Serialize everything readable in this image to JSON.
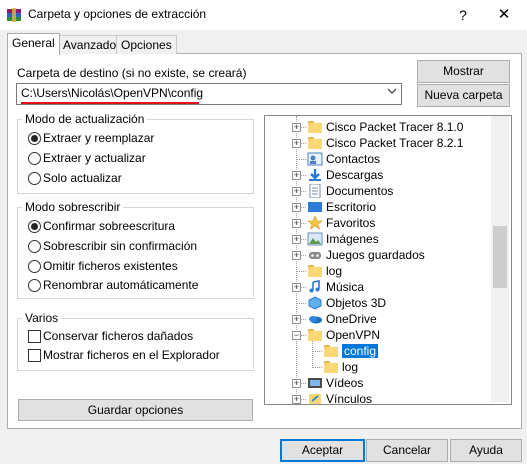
{
  "window": {
    "title": "Carpeta y opciones de extracción",
    "help_label": "?",
    "close_label": "✕"
  },
  "tabs": [
    {
      "label": "General",
      "active": true
    },
    {
      "label": "Avanzado",
      "active": false
    },
    {
      "label": "Opciones",
      "active": false
    }
  ],
  "destination": {
    "label": "Carpeta de destino (si no existe, se creará)",
    "value": "C:\\Users\\Nicolás\\OpenVPN\\config"
  },
  "buttons": {
    "show": "Mostrar",
    "new_folder": "Nueva carpeta",
    "save_options": "Guardar opciones",
    "accept": "Aceptar",
    "cancel": "Cancelar",
    "help": "Ayuda"
  },
  "update_mode": {
    "title": "Modo de actualización",
    "options": [
      {
        "label": "Extraer y reemplazar",
        "selected": true
      },
      {
        "label": "Extraer y actualizar",
        "selected": false
      },
      {
        "label": "Solo actualizar",
        "selected": false
      }
    ]
  },
  "overwrite_mode": {
    "title": "Modo sobrescribir",
    "options": [
      {
        "label": "Confirmar sobreescritura",
        "selected": true
      },
      {
        "label": "Sobrescribir sin confirmación",
        "selected": false
      },
      {
        "label": "Omitir ficheros existentes",
        "selected": false
      },
      {
        "label": "Renombrar automáticamente",
        "selected": false
      }
    ]
  },
  "misc": {
    "title": "Varios",
    "options": [
      {
        "label": "Conservar ficheros dañados",
        "checked": false
      },
      {
        "label": "Mostrar ficheros en el Explorador",
        "checked": false
      }
    ]
  },
  "tree": {
    "items": [
      {
        "label": "Cisco Packet Tracer 8.1.0",
        "icon": "folder-icon",
        "expandable": true
      },
      {
        "label": "Cisco Packet Tracer 8.2.1",
        "icon": "folder-icon",
        "expandable": true
      },
      {
        "label": "Contactos",
        "icon": "contacts-icon",
        "expandable": false
      },
      {
        "label": "Descargas",
        "icon": "downloads-icon",
        "expandable": true
      },
      {
        "label": "Documentos",
        "icon": "documents-icon",
        "expandable": true
      },
      {
        "label": "Escritorio",
        "icon": "desktop-icon",
        "expandable": true
      },
      {
        "label": "Favoritos",
        "icon": "favorites-icon",
        "expandable": true
      },
      {
        "label": "Imágenes",
        "icon": "pictures-icon",
        "expandable": true
      },
      {
        "label": "Juegos guardados",
        "icon": "saved-games-icon",
        "expandable": true
      },
      {
        "label": "log",
        "icon": "folder-icon",
        "expandable": false
      },
      {
        "label": "Música",
        "icon": "music-icon",
        "expandable": true
      },
      {
        "label": "Objetos 3D",
        "icon": "objects-3d-icon",
        "expandable": false
      },
      {
        "label": "OneDrive",
        "icon": "onedrive-icon",
        "expandable": true
      },
      {
        "label": "OpenVPN",
        "icon": "folder-icon",
        "expandable": true,
        "expanded": true
      },
      {
        "label": "config",
        "icon": "folder-icon",
        "expandable": false,
        "child": true,
        "selected": true
      },
      {
        "label": "log",
        "icon": "folder-icon",
        "expandable": false,
        "child": true
      },
      {
        "label": "Vídeos",
        "icon": "videos-icon",
        "expandable": true
      },
      {
        "label": "Vínculos",
        "icon": "links-icon",
        "expandable": true
      }
    ]
  },
  "colors": {
    "selection": "#0078d7",
    "underline": "#e0101a",
    "folder": "#f8d775"
  }
}
